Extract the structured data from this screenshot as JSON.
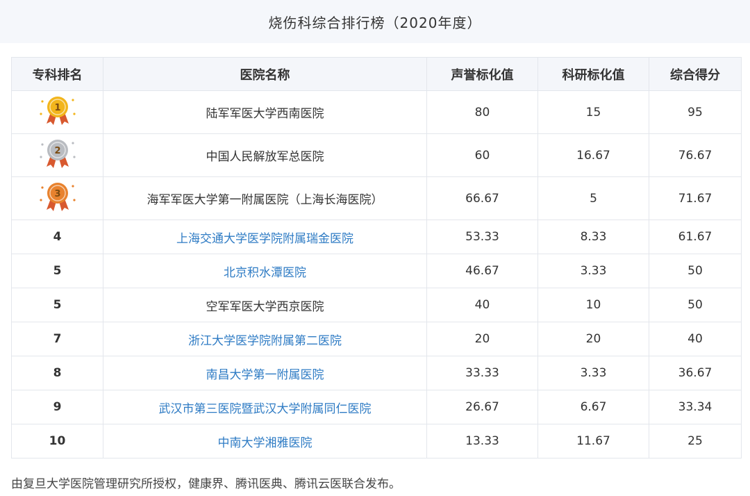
{
  "title": "烧伤科综合排行榜（2020年度）",
  "colors": {
    "header_bg": "#f5f7fb",
    "link": "#2e7bc4",
    "gold": "#f2b51c",
    "silver": "#b9bcc1",
    "bronze": "#e8822e",
    "ribbon": "#d8592f"
  },
  "table": {
    "headers": [
      "专科排名",
      "医院名称",
      "声誉标化值",
      "科研标化值",
      "综合得分"
    ],
    "rows": [
      {
        "rank": "1",
        "medal": "gold",
        "name": "陆军军医大学西南医院",
        "linked": false,
        "reputation": "80",
        "research": "15",
        "score": "95"
      },
      {
        "rank": "2",
        "medal": "silver",
        "name": "中国人民解放军总医院",
        "linked": false,
        "reputation": "60",
        "research": "16.67",
        "score": "76.67"
      },
      {
        "rank": "3",
        "medal": "bronze",
        "name": "海军军医大学第一附属医院（上海长海医院）",
        "linked": false,
        "reputation": "66.67",
        "research": "5",
        "score": "71.67"
      },
      {
        "rank": "4",
        "medal": "",
        "name": "上海交通大学医学院附属瑞金医院",
        "linked": true,
        "reputation": "53.33",
        "research": "8.33",
        "score": "61.67"
      },
      {
        "rank": "5",
        "medal": "",
        "name": "北京积水潭医院",
        "linked": true,
        "reputation": "46.67",
        "research": "3.33",
        "score": "50"
      },
      {
        "rank": "5",
        "medal": "",
        "name": "空军军医大学西京医院",
        "linked": false,
        "reputation": "40",
        "research": "10",
        "score": "50"
      },
      {
        "rank": "7",
        "medal": "",
        "name": "浙江大学医学院附属第二医院",
        "linked": true,
        "reputation": "20",
        "research": "20",
        "score": "40"
      },
      {
        "rank": "8",
        "medal": "",
        "name": "南昌大学第一附属医院",
        "linked": true,
        "reputation": "33.33",
        "research": "3.33",
        "score": "36.67"
      },
      {
        "rank": "9",
        "medal": "",
        "name": "武汉市第三医院暨武汉大学附属同仁医院",
        "linked": true,
        "reputation": "26.67",
        "research": "6.67",
        "score": "33.34"
      },
      {
        "rank": "10",
        "medal": "",
        "name": "中南大学湘雅医院",
        "linked": true,
        "reputation": "13.33",
        "research": "11.67",
        "score": "25"
      }
    ]
  },
  "footnote": "由复旦大学医院管理研究所授权，健康界、腾讯医典、腾讯云医联合发布。"
}
